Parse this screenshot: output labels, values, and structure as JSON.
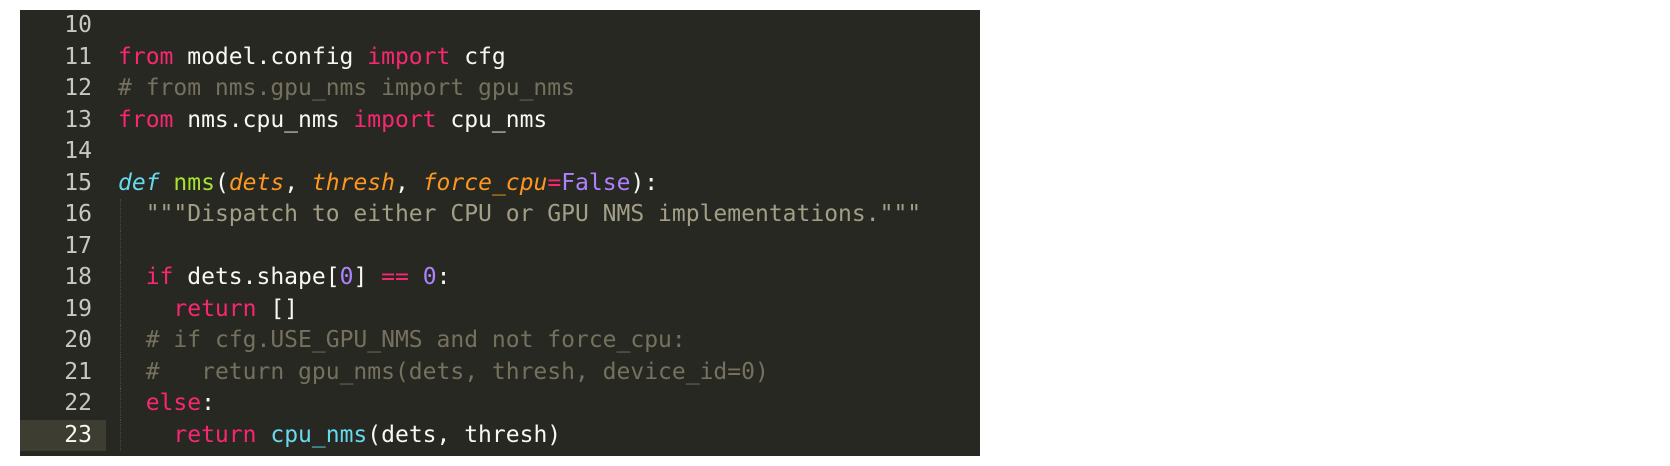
{
  "editor": {
    "background": "#272822",
    "current_line": "23",
    "lines": [
      {
        "n": "10",
        "tokens": []
      },
      {
        "n": "11",
        "tokens": [
          {
            "t": "kw",
            "v": "from"
          },
          {
            "t": "plain",
            "v": " model.config "
          },
          {
            "t": "kw",
            "v": "import"
          },
          {
            "t": "plain",
            "v": " cfg"
          }
        ]
      },
      {
        "n": "12",
        "tokens": [
          {
            "t": "cmt",
            "v": "# from nms.gpu_nms import gpu_nms"
          }
        ]
      },
      {
        "n": "13",
        "tokens": [
          {
            "t": "kw",
            "v": "from"
          },
          {
            "t": "plain",
            "v": " nms.cpu_nms "
          },
          {
            "t": "kw",
            "v": "import"
          },
          {
            "t": "plain",
            "v": " cpu_nms"
          }
        ]
      },
      {
        "n": "14",
        "tokens": []
      },
      {
        "n": "15",
        "tokens": [
          {
            "t": "def",
            "v": "def"
          },
          {
            "t": "plain",
            "v": " "
          },
          {
            "t": "fn",
            "v": "nms"
          },
          {
            "t": "plain",
            "v": "("
          },
          {
            "t": "arg",
            "v": "dets"
          },
          {
            "t": "plain",
            "v": ", "
          },
          {
            "t": "arg",
            "v": "thresh"
          },
          {
            "t": "plain",
            "v": ", "
          },
          {
            "t": "arg",
            "v": "force_cpu"
          },
          {
            "t": "kw",
            "v": "="
          },
          {
            "t": "num",
            "v": "False"
          },
          {
            "t": "plain",
            "v": "):"
          }
        ]
      },
      {
        "n": "16",
        "tokens": [
          {
            "t": "plain",
            "v": "  "
          },
          {
            "t": "str",
            "v": "\"\"\"Dispatch to either CPU or GPU NMS implementations.\"\"\""
          }
        ]
      },
      {
        "n": "17",
        "tokens": []
      },
      {
        "n": "18",
        "tokens": [
          {
            "t": "plain",
            "v": "  "
          },
          {
            "t": "kw",
            "v": "if"
          },
          {
            "t": "plain",
            "v": " dets.shape["
          },
          {
            "t": "num",
            "v": "0"
          },
          {
            "t": "plain",
            "v": "] "
          },
          {
            "t": "kw",
            "v": "=="
          },
          {
            "t": "plain",
            "v": " "
          },
          {
            "t": "num",
            "v": "0"
          },
          {
            "t": "plain",
            "v": ":"
          }
        ]
      },
      {
        "n": "19",
        "tokens": [
          {
            "t": "plain",
            "v": "    "
          },
          {
            "t": "kw",
            "v": "return"
          },
          {
            "t": "plain",
            "v": " []"
          }
        ]
      },
      {
        "n": "20",
        "tokens": [
          {
            "t": "plain",
            "v": "  "
          },
          {
            "t": "cmt",
            "v": "# if cfg.USE_GPU_NMS and not force_cpu:"
          }
        ]
      },
      {
        "n": "21",
        "tokens": [
          {
            "t": "plain",
            "v": "  "
          },
          {
            "t": "cmt",
            "v": "#   return gpu_nms(dets, thresh, device_id=0)"
          }
        ]
      },
      {
        "n": "22",
        "tokens": [
          {
            "t": "plain",
            "v": "  "
          },
          {
            "t": "kw",
            "v": "else"
          },
          {
            "t": "plain",
            "v": ":"
          }
        ]
      },
      {
        "n": "23",
        "tokens": [
          {
            "t": "plain",
            "v": "    "
          },
          {
            "t": "kw",
            "v": "return"
          },
          {
            "t": "plain",
            "v": " "
          },
          {
            "t": "call",
            "v": "cpu_nms"
          },
          {
            "t": "plain",
            "v": "(dets, thresh)"
          }
        ]
      }
    ]
  }
}
